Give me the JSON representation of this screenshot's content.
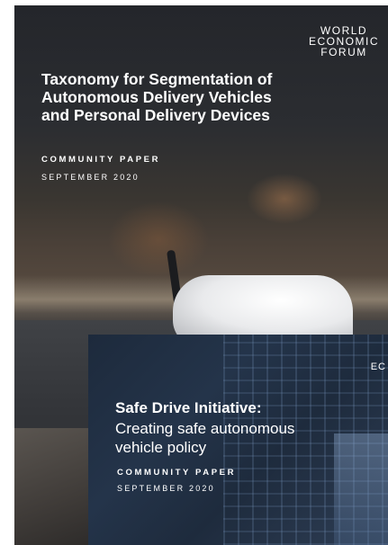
{
  "papers": [
    {
      "title": "Taxonomy for Segmentation of Autonomous Delivery Vehicles and Personal Delivery Devices",
      "type": "COMMUNITY PAPER",
      "date": "SEPTEMBER 2020",
      "logo": [
        "WORLD",
        "ECONOMIC",
        "FORUM"
      ]
    },
    {
      "title": "Safe Drive Initiative:",
      "subtitle": "Creating safe autonomous vehicle policy",
      "type": "COMMUNITY PAPER",
      "date": "SEPTEMBER 2020",
      "logo_fragment": "EC"
    }
  ]
}
